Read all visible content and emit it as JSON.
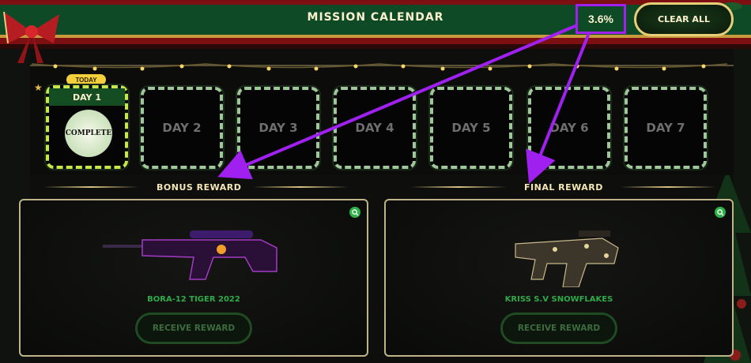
{
  "header": {
    "title": "MISSION CALENDAR",
    "progress_percent": "3.6%",
    "clear_all_label": "CLEAR ALL"
  },
  "calendar": {
    "today_badge": "TODAY",
    "days": [
      {
        "label": "DAY 1",
        "status": "COMPLETE"
      },
      {
        "label": "DAY 2"
      },
      {
        "label": "DAY 3"
      },
      {
        "label": "DAY 4"
      },
      {
        "label": "DAY 5"
      },
      {
        "label": "DAY 6"
      },
      {
        "label": "DAY 7"
      }
    ]
  },
  "rewards": {
    "bonus": {
      "section_label": "BONUS REWARD",
      "item_name": "BORA-12 TIGER 2022",
      "button_label": "RECEIVE REWARD"
    },
    "final": {
      "section_label": "FINAL REWARD",
      "item_name": "KRISS S.V SNOWFLAKES",
      "button_label": "RECEIVE REWARD"
    }
  },
  "colors": {
    "header_green": "#0e4a26",
    "header_red": "#7c0f12",
    "gold": "#e7cf7a",
    "annotation_purple": "#a020f0",
    "reward_name_green": "#2faa49"
  },
  "icons": {
    "zoom": "zoom-icon",
    "bow": "ribbon-bow-icon",
    "star": "star-icon"
  }
}
